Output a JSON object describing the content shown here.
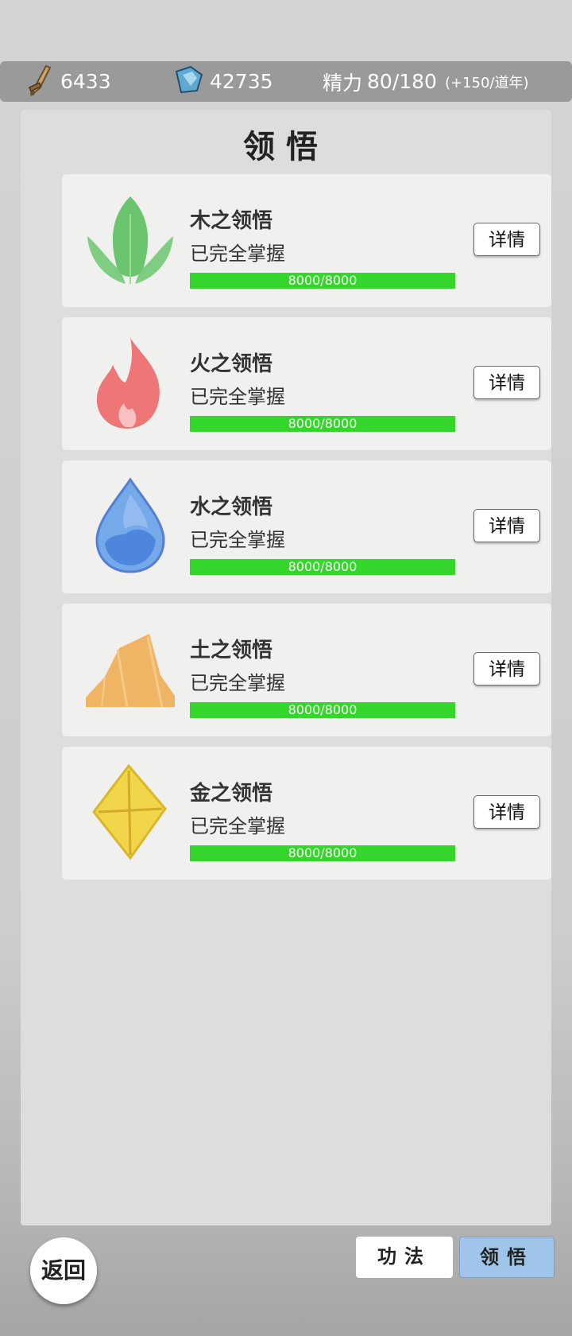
{
  "resources": {
    "stat1_icon": "sword-icon",
    "stat1_value": "6433",
    "stat2_icon": "crystal-icon",
    "stat2_value": "42735",
    "energy_label": "精力",
    "energy_value": "80/180",
    "energy_regen": "(+150/道年)"
  },
  "panel": {
    "title": "领悟"
  },
  "cards": [
    {
      "name": "木之领悟",
      "icon": "leaf-icon",
      "status": "已完全掌握",
      "progress_text": "8000/8000",
      "progress": 1.0,
      "button": "详情"
    },
    {
      "name": "火之领悟",
      "icon": "flame-icon",
      "status": "已完全掌握",
      "progress_text": "8000/8000",
      "progress": 1.0,
      "button": "详情"
    },
    {
      "name": "水之领悟",
      "icon": "water-drop-icon",
      "status": "已完全掌握",
      "progress_text": "8000/8000",
      "progress": 1.0,
      "button": "详情"
    },
    {
      "name": "土之领悟",
      "icon": "mountain-icon",
      "status": "已完全掌握",
      "progress_text": "8000/8000",
      "progress": 1.0,
      "button": "详情"
    },
    {
      "name": "金之领悟",
      "icon": "diamond-icon",
      "status": "已完全掌握",
      "progress_text": "8000/8000",
      "progress": 1.0,
      "button": "详情"
    }
  ],
  "footer": {
    "back": "返回",
    "tab1": "功法",
    "tab2": "领悟"
  },
  "colors": {
    "progress_fill": "#35d62b",
    "active_tab": "#9fc6ea"
  }
}
